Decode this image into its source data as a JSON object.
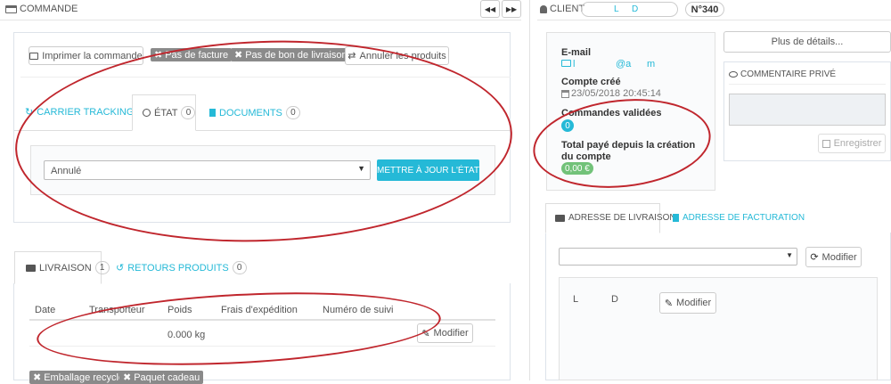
{
  "left_header": {
    "title": "COMMANDE"
  },
  "nav": {
    "prev": "◀◀",
    "next": "▶▶"
  },
  "right_header": {
    "title": "CLIENT",
    "client_initial_1": "L",
    "client_initial_2": "D",
    "order_number": "N°340"
  },
  "actions": {
    "print": "Imprimer la commande",
    "no_invoice": "Pas de facture",
    "no_delivery_slip": "Pas de bon de livraison",
    "cancel_products": "Annuler les produits"
  },
  "tabs1": [
    {
      "label": "CARRIER TRACKING"
    },
    {
      "label": "ÉTAT",
      "count": "0"
    },
    {
      "label": "DOCUMENTS",
      "count": "0"
    }
  ],
  "state": {
    "selected": "Annulé",
    "update_button": "METTRE À JOUR L'ÉTAT"
  },
  "tabs2": [
    {
      "label": "LIVRAISON",
      "count": "1"
    },
    {
      "label": "RETOURS PRODUITS",
      "count": "0"
    }
  ],
  "shipping_table": {
    "headers": [
      "Date",
      "Transporteur",
      "Poids",
      "Frais d'expédition",
      "Numéro de suivi"
    ],
    "row": {
      "weight": "0.000 kg"
    },
    "edit_button": "Modifier"
  },
  "bottom_tags": {
    "recycled": "Emballage recyclé",
    "gift": "Paquet cadeau"
  },
  "customer": {
    "email_label": "E-mail",
    "email_value_1": "l",
    "email_value_2": "@a",
    "email_value_3": "m",
    "created_label": "Compte créé",
    "created_value": "23/05/2018 20:45:14",
    "validated_label": "Commandes validées",
    "validated_count": "0",
    "total_label": "Total payé depuis la création du compte",
    "total_value": "0,00 €"
  },
  "more_details": "Plus de détails...",
  "private_note": {
    "title": "COMMENTAIRE PRIVÉ",
    "save": "Enregistrer"
  },
  "address_tabs": [
    {
      "label": "ADRESSE DE LIVRAISON"
    },
    {
      "label": "ADRESSE DE FACTURATION"
    }
  ],
  "address": {
    "modify": "Modifier",
    "initial_1": "L",
    "initial_2": "D",
    "modify2": "Modifier"
  },
  "colors": {
    "accent": "#25b9d7",
    "annotation": "#c0262d",
    "success": "#72c279"
  }
}
